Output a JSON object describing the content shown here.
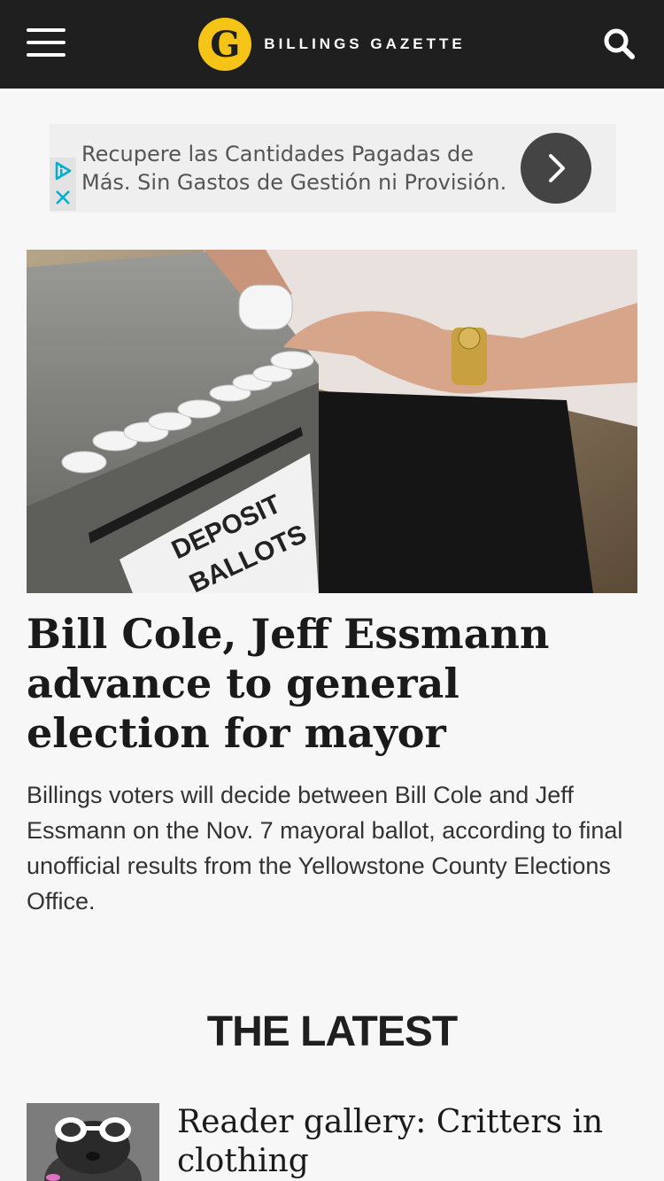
{
  "header": {
    "logo_letter": "G",
    "brand_name": "BILLINGS GAZETTE"
  },
  "ad": {
    "text": "Recupere las Cantidades Pagadas de Más. Sin Gastos de Gestión ni Provisión."
  },
  "hero": {
    "photo_sign_text_1": "DEPOSIT",
    "photo_sign_text_2": "BALLOTS",
    "headline": "Bill Cole, Jeff Essmann advance to general election for mayor",
    "summary": "Billings voters will decide between Bill Cole and Jeff Essmann on the Nov. 7 mayoral ballot, according to final unofficial results from the Yellowstone County Elections Office."
  },
  "latest": {
    "title": "THE LATEST",
    "items": [
      {
        "headline": "Reader gallery: Critters in clothing"
      }
    ]
  },
  "colors": {
    "header_bg": "#1f1f1f",
    "logo_yellow": "#f6c416",
    "ad_accent": "#00aecd"
  }
}
